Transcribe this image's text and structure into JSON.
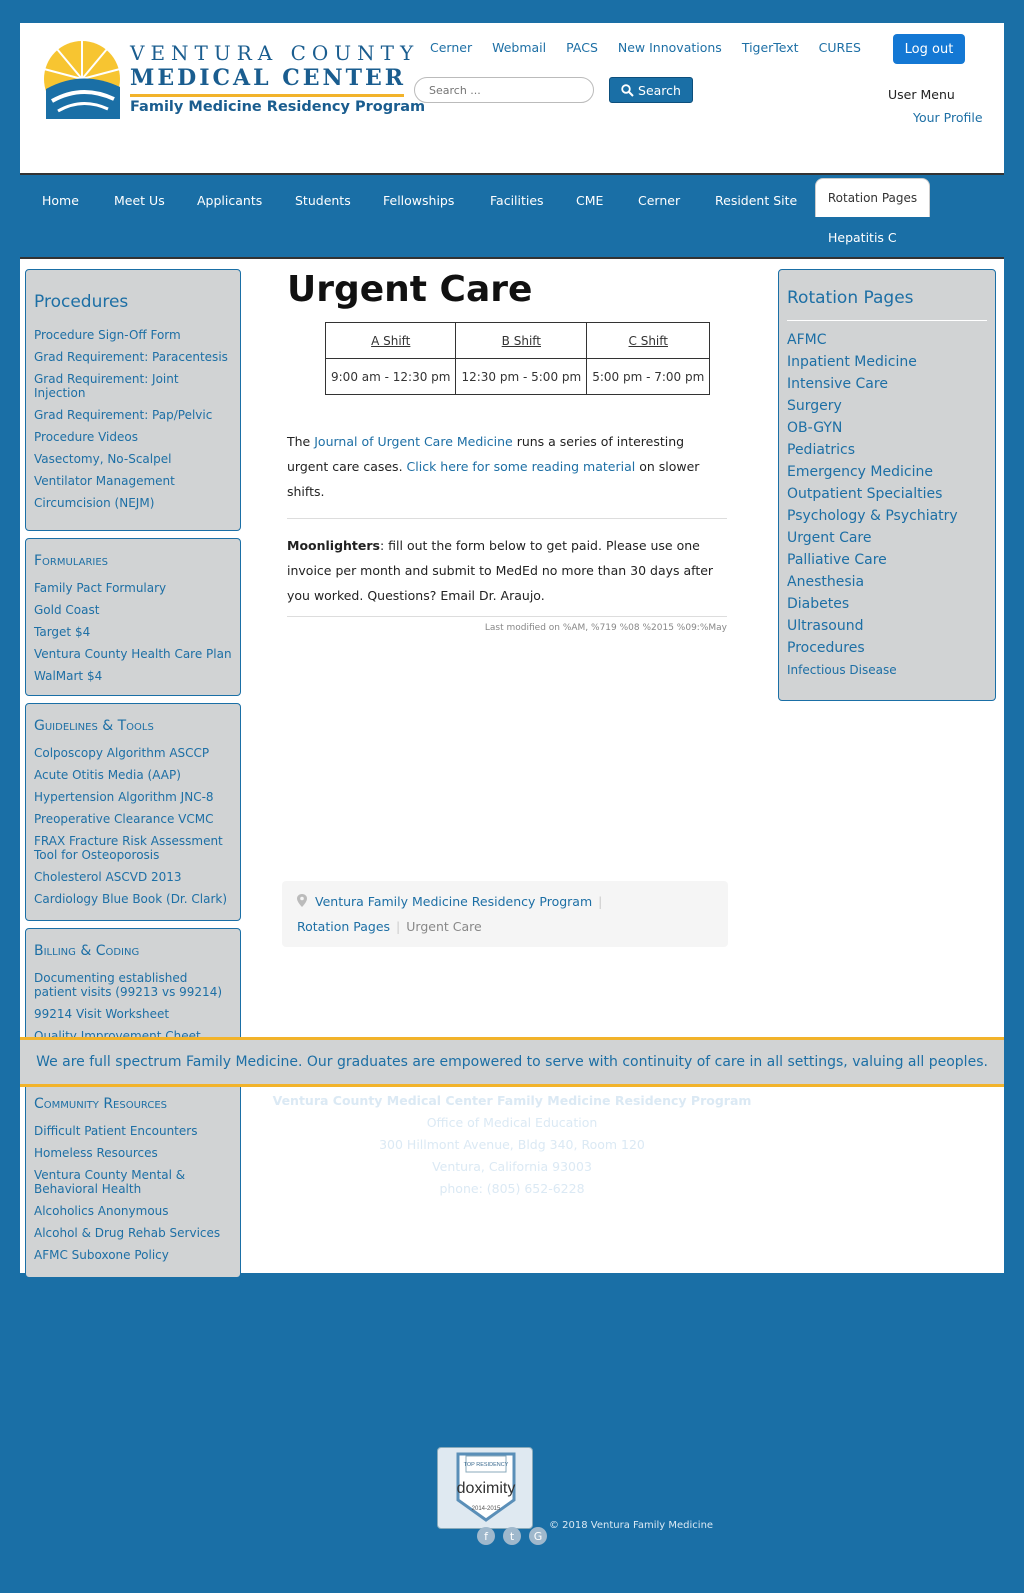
{
  "header": {
    "logo_line1": "VENTURA COUNTY",
    "logo_line2": "MEDICAL CENTER",
    "logo_line3": "Family Medicine Residency Program",
    "top_links": [
      "Cerner",
      "Webmail",
      "PACS",
      "New Innovations",
      "TigerText",
      "CURES"
    ],
    "search_placeholder": "Search ...",
    "search_label": "Search",
    "logout_label": "Log out",
    "user_menu": "User Menu",
    "your_profile": "Your Profile"
  },
  "nav": {
    "items": [
      "Home",
      "Meet Us",
      "Applicants",
      "Students",
      "Fellowships",
      "Facilities",
      "CME",
      "Cerner",
      "Resident Site"
    ],
    "active": "Rotation Pages",
    "sub": "Hepatitis C"
  },
  "left_sidebar": {
    "procedures": {
      "title": "Procedures",
      "links": [
        "Procedure Sign-Off Form",
        "Grad Requirement: Paracentesis",
        "Grad Requirement: Joint Injection",
        "Grad Requirement: Pap/Pelvic",
        "Procedure Videos",
        "Vasectomy, No-Scalpel",
        "Ventilator Management",
        "Circumcision (NEJM)"
      ]
    },
    "formularies": {
      "title": "Formularies",
      "links": [
        "Family Pact Formulary",
        "Gold Coast",
        "Target $4",
        "Ventura County Health Care Plan",
        "WalMart $4"
      ]
    },
    "guidelines": {
      "title": "Guidelines & Tools",
      "links": [
        "Colposcopy Algorithm ASCCP",
        "Acute Otitis Media (AAP)",
        "Hypertension Algorithm JNC-8",
        "Preoperative Clearance VCMC",
        "FRAX Fracture Risk Assessment Tool for Osteoporosis",
        "Cholesterol ASCVD 2013",
        "Cardiology Blue Book (Dr. Clark)"
      ]
    },
    "billing": {
      "title": "Billing & Coding",
      "links": [
        "Documenting established patient visits (99213 vs 99214)",
        "99214 Visit Worksheet",
        "Quality Improvement Cheet Sheet"
      ]
    },
    "community": {
      "title": "Community Resources",
      "links": [
        "Difficult Patient Encounters",
        "Homeless Resources",
        "Ventura County Mental & Behavioral Health",
        "Alcoholics Anonymous",
        "Alcohol & Drug Rehab Services",
        "AFMC Suboxone Policy"
      ]
    }
  },
  "content": {
    "title": "Urgent Care",
    "shift_headers": [
      "A Shift",
      "B Shift",
      "C Shift"
    ],
    "shift_times": [
      "9:00 am - 12:30 pm",
      "12:30 pm - 5:00 pm",
      "5:00 pm - 7:00 pm"
    ],
    "p1_start": "The ",
    "p1_link1": "Journal of Urgent Care Medicine",
    "p1_mid": " runs a series of interesting urgent care cases.  ",
    "p1_link2": "Click here for some reading material",
    "p1_end": " on slower shifts.",
    "p2_bold": "Moonlighters",
    "p2_rest": ": fill out the form below to get paid.  Please use one invoice per month and submit to MedEd no more than 30 days after you worked.  Questions?  Email Dr. Araujo.",
    "last_modified": "Last modified on %AM, %719 %08 %2015 %09:%May",
    "breadcrumb": [
      "Ventura Family Medicine Residency Program",
      "Rotation Pages",
      "Urgent Care"
    ]
  },
  "right_sidebar": {
    "title": "Rotation Pages",
    "links": [
      "AFMC",
      "Inpatient Medicine",
      "Intensive Care",
      "Surgery",
      "OB-GYN",
      "Pediatrics",
      "Emergency Medicine",
      "Outpatient Specialties",
      "Psychology & Psychiatry",
      "Urgent Care",
      "Palliative Care",
      "Anesthesia",
      "Diabetes",
      "Ultrasound",
      "Procedures"
    ],
    "last_link": "Infectious Disease"
  },
  "mission": "We are full spectrum Family Medicine. Our graduates are empowered to serve with continuity of care in all settings, valuing all peoples.",
  "footer": {
    "org": "Ventura County Medical Center Family Medicine Residency Program",
    "office": "Office of Medical Education",
    "address": "300 Hillmont Avenue, Bldg 340, Room 120",
    "city": "Ventura, California 93003",
    "phone": "phone: (805) 652-6228",
    "badge_top": "TOP RESIDENCY",
    "badge_name": "doximity",
    "badge_years": "2014-2015",
    "copyright": "© 2018 Ventura Family Medicine"
  },
  "colors": {
    "brand_blue": "#1a6fa6",
    "accent_gold": "#f2b32a",
    "sidebar_gray": "#d1d3d4"
  }
}
